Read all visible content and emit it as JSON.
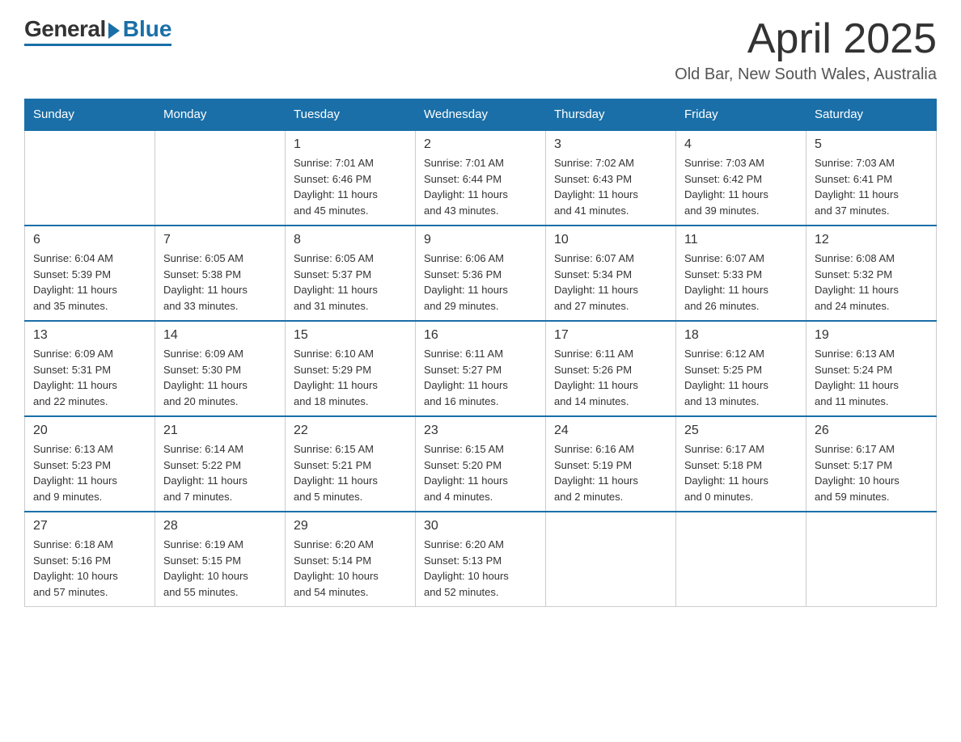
{
  "logo": {
    "general": "General",
    "blue": "Blue"
  },
  "title": "April 2025",
  "subtitle": "Old Bar, New South Wales, Australia",
  "days_of_week": [
    "Sunday",
    "Monday",
    "Tuesday",
    "Wednesday",
    "Thursday",
    "Friday",
    "Saturday"
  ],
  "weeks": [
    [
      {
        "day": "",
        "info": ""
      },
      {
        "day": "",
        "info": ""
      },
      {
        "day": "1",
        "info": "Sunrise: 7:01 AM\nSunset: 6:46 PM\nDaylight: 11 hours\nand 45 minutes."
      },
      {
        "day": "2",
        "info": "Sunrise: 7:01 AM\nSunset: 6:44 PM\nDaylight: 11 hours\nand 43 minutes."
      },
      {
        "day": "3",
        "info": "Sunrise: 7:02 AM\nSunset: 6:43 PM\nDaylight: 11 hours\nand 41 minutes."
      },
      {
        "day": "4",
        "info": "Sunrise: 7:03 AM\nSunset: 6:42 PM\nDaylight: 11 hours\nand 39 minutes."
      },
      {
        "day": "5",
        "info": "Sunrise: 7:03 AM\nSunset: 6:41 PM\nDaylight: 11 hours\nand 37 minutes."
      }
    ],
    [
      {
        "day": "6",
        "info": "Sunrise: 6:04 AM\nSunset: 5:39 PM\nDaylight: 11 hours\nand 35 minutes."
      },
      {
        "day": "7",
        "info": "Sunrise: 6:05 AM\nSunset: 5:38 PM\nDaylight: 11 hours\nand 33 minutes."
      },
      {
        "day": "8",
        "info": "Sunrise: 6:05 AM\nSunset: 5:37 PM\nDaylight: 11 hours\nand 31 minutes."
      },
      {
        "day": "9",
        "info": "Sunrise: 6:06 AM\nSunset: 5:36 PM\nDaylight: 11 hours\nand 29 minutes."
      },
      {
        "day": "10",
        "info": "Sunrise: 6:07 AM\nSunset: 5:34 PM\nDaylight: 11 hours\nand 27 minutes."
      },
      {
        "day": "11",
        "info": "Sunrise: 6:07 AM\nSunset: 5:33 PM\nDaylight: 11 hours\nand 26 minutes."
      },
      {
        "day": "12",
        "info": "Sunrise: 6:08 AM\nSunset: 5:32 PM\nDaylight: 11 hours\nand 24 minutes."
      }
    ],
    [
      {
        "day": "13",
        "info": "Sunrise: 6:09 AM\nSunset: 5:31 PM\nDaylight: 11 hours\nand 22 minutes."
      },
      {
        "day": "14",
        "info": "Sunrise: 6:09 AM\nSunset: 5:30 PM\nDaylight: 11 hours\nand 20 minutes."
      },
      {
        "day": "15",
        "info": "Sunrise: 6:10 AM\nSunset: 5:29 PM\nDaylight: 11 hours\nand 18 minutes."
      },
      {
        "day": "16",
        "info": "Sunrise: 6:11 AM\nSunset: 5:27 PM\nDaylight: 11 hours\nand 16 minutes."
      },
      {
        "day": "17",
        "info": "Sunrise: 6:11 AM\nSunset: 5:26 PM\nDaylight: 11 hours\nand 14 minutes."
      },
      {
        "day": "18",
        "info": "Sunrise: 6:12 AM\nSunset: 5:25 PM\nDaylight: 11 hours\nand 13 minutes."
      },
      {
        "day": "19",
        "info": "Sunrise: 6:13 AM\nSunset: 5:24 PM\nDaylight: 11 hours\nand 11 minutes."
      }
    ],
    [
      {
        "day": "20",
        "info": "Sunrise: 6:13 AM\nSunset: 5:23 PM\nDaylight: 11 hours\nand 9 minutes."
      },
      {
        "day": "21",
        "info": "Sunrise: 6:14 AM\nSunset: 5:22 PM\nDaylight: 11 hours\nand 7 minutes."
      },
      {
        "day": "22",
        "info": "Sunrise: 6:15 AM\nSunset: 5:21 PM\nDaylight: 11 hours\nand 5 minutes."
      },
      {
        "day": "23",
        "info": "Sunrise: 6:15 AM\nSunset: 5:20 PM\nDaylight: 11 hours\nand 4 minutes."
      },
      {
        "day": "24",
        "info": "Sunrise: 6:16 AM\nSunset: 5:19 PM\nDaylight: 11 hours\nand 2 minutes."
      },
      {
        "day": "25",
        "info": "Sunrise: 6:17 AM\nSunset: 5:18 PM\nDaylight: 11 hours\nand 0 minutes."
      },
      {
        "day": "26",
        "info": "Sunrise: 6:17 AM\nSunset: 5:17 PM\nDaylight: 10 hours\nand 59 minutes."
      }
    ],
    [
      {
        "day": "27",
        "info": "Sunrise: 6:18 AM\nSunset: 5:16 PM\nDaylight: 10 hours\nand 57 minutes."
      },
      {
        "day": "28",
        "info": "Sunrise: 6:19 AM\nSunset: 5:15 PM\nDaylight: 10 hours\nand 55 minutes."
      },
      {
        "day": "29",
        "info": "Sunrise: 6:20 AM\nSunset: 5:14 PM\nDaylight: 10 hours\nand 54 minutes."
      },
      {
        "day": "30",
        "info": "Sunrise: 6:20 AM\nSunset: 5:13 PM\nDaylight: 10 hours\nand 52 minutes."
      },
      {
        "day": "",
        "info": ""
      },
      {
        "day": "",
        "info": ""
      },
      {
        "day": "",
        "info": ""
      }
    ]
  ]
}
